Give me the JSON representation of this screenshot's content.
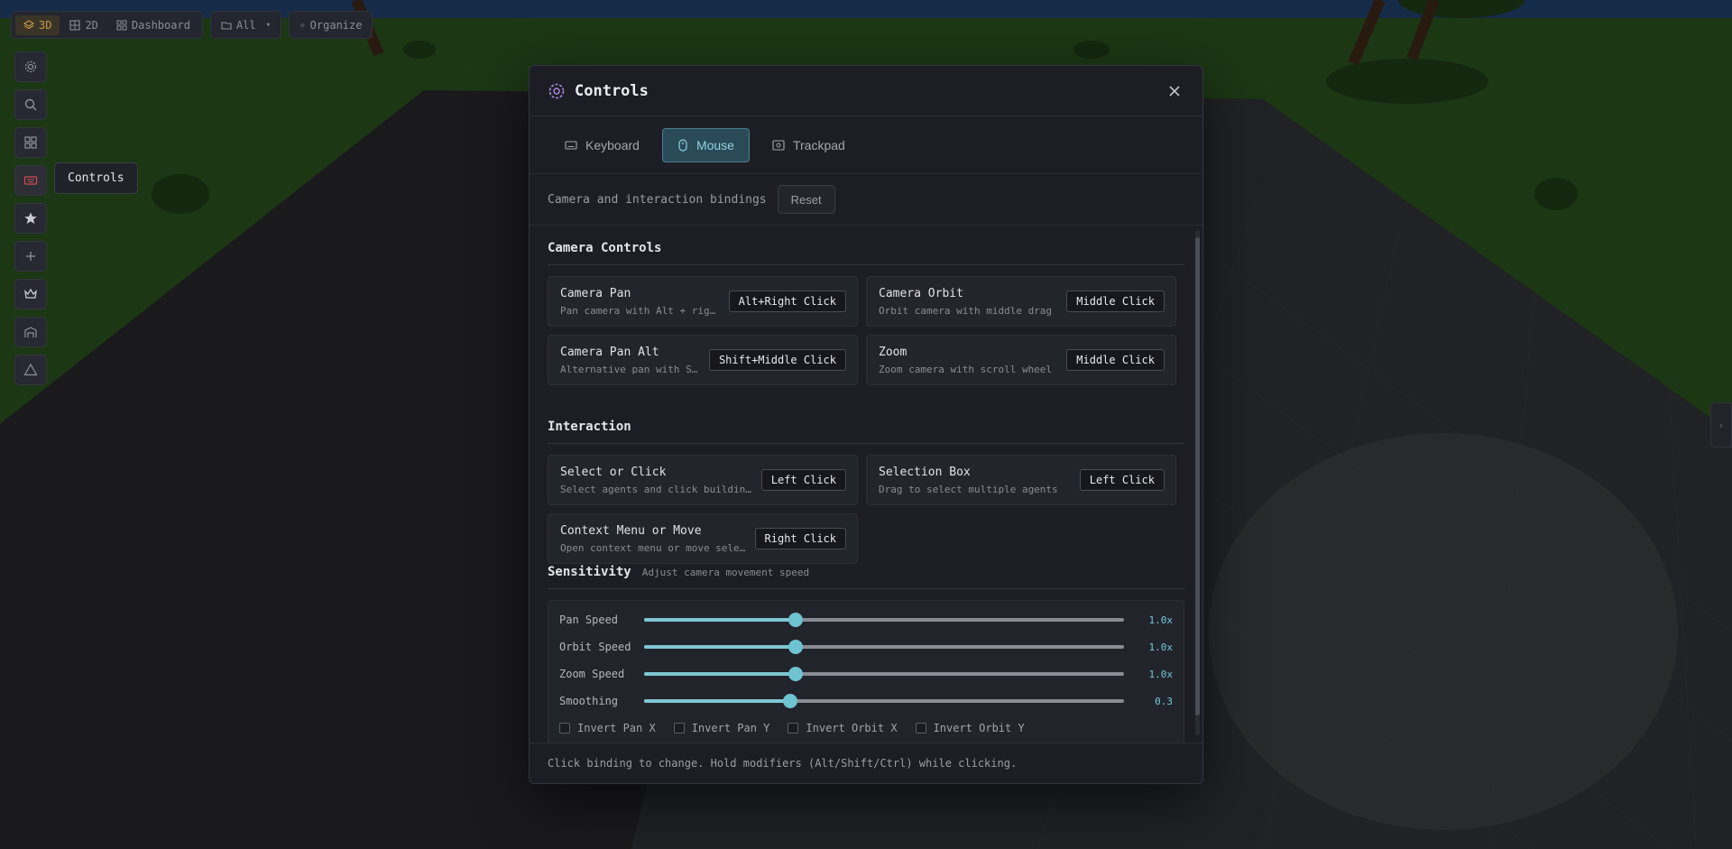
{
  "topbar": {
    "views": [
      {
        "label": "3D",
        "icon": "layers-icon",
        "active": true
      },
      {
        "label": "2D",
        "icon": "grid-icon",
        "active": false
      },
      {
        "label": "Dashboard",
        "icon": "dashboard-icon",
        "active": false
      }
    ],
    "filter_label": "All",
    "organize_label": "Organize"
  },
  "sidebar": {
    "items": [
      {
        "name": "settings",
        "icon": "gear-icon"
      },
      {
        "name": "search",
        "icon": "search-icon"
      },
      {
        "name": "apps",
        "icon": "grid-icon"
      },
      {
        "name": "controls",
        "icon": "keyboard-icon",
        "active": true
      },
      {
        "name": "favorites",
        "icon": "star-icon"
      },
      {
        "name": "add",
        "icon": "plus-icon"
      },
      {
        "name": "crown",
        "icon": "crown-icon"
      },
      {
        "name": "buildings",
        "icon": "building-icon"
      },
      {
        "name": "warning",
        "icon": "triangle-icon"
      }
    ],
    "tooltip": "Controls"
  },
  "modal": {
    "title": "Controls",
    "tabs": [
      {
        "label": "Keyboard",
        "icon": "keyboard-icon",
        "active": false
      },
      {
        "label": "Mouse",
        "icon": "mouse-icon",
        "active": true
      },
      {
        "label": "Trackpad",
        "icon": "trackpad-icon",
        "active": false
      }
    ],
    "subtitle": "Camera and interaction bindings",
    "reset_label": "Reset",
    "camera": {
      "title": "Camera Controls",
      "items": [
        {
          "name": "Camera Pan",
          "desc": "Pan camera with Alt + right drag",
          "binding": "Alt+Right Click"
        },
        {
          "name": "Camera Orbit",
          "desc": "Orbit camera with middle drag",
          "binding": "Middle Click"
        },
        {
          "name": "Camera Pan Alt",
          "desc": "Alternative pan with Shift + middle drag",
          "binding": "Shift+Middle Click"
        },
        {
          "name": "Zoom",
          "desc": "Zoom camera with scroll wheel",
          "binding": "Middle Click"
        }
      ]
    },
    "interaction": {
      "title": "Interaction",
      "items": [
        {
          "name": "Select or Click",
          "desc": "Select agents and click buildings or objects",
          "binding": "Left Click"
        },
        {
          "name": "Selection Box",
          "desc": "Drag to select multiple agents",
          "binding": "Left Click"
        },
        {
          "name": "Context Menu or Move",
          "desc": "Open context menu or move selected agents",
          "binding": "Right Click"
        }
      ]
    },
    "sensitivity": {
      "title": "Sensitivity",
      "desc": "Adjust camera movement speed",
      "sliders": [
        {
          "label": "Pan Speed",
          "value": "1.0x",
          "fraction": 0.316
        },
        {
          "label": "Orbit Speed",
          "value": "1.0x",
          "fraction": 0.316
        },
        {
          "label": "Zoom Speed",
          "value": "1.0x",
          "fraction": 0.316
        },
        {
          "label": "Smoothing",
          "value": "0.3",
          "fraction": 0.305
        }
      ],
      "checkboxes": [
        {
          "label": "Invert Pan X",
          "checked": false
        },
        {
          "label": "Invert Pan Y",
          "checked": false
        },
        {
          "label": "Invert Orbit X",
          "checked": false
        },
        {
          "label": "Invert Orbit Y",
          "checked": false
        }
      ]
    },
    "footer": "Click binding to change. Hold modifiers (Alt/Shift/Ctrl) while clicking."
  },
  "colors": {
    "accent": "#6ec3d1",
    "active_view": "#c99a4e",
    "title_icon": "#a98ad8"
  }
}
